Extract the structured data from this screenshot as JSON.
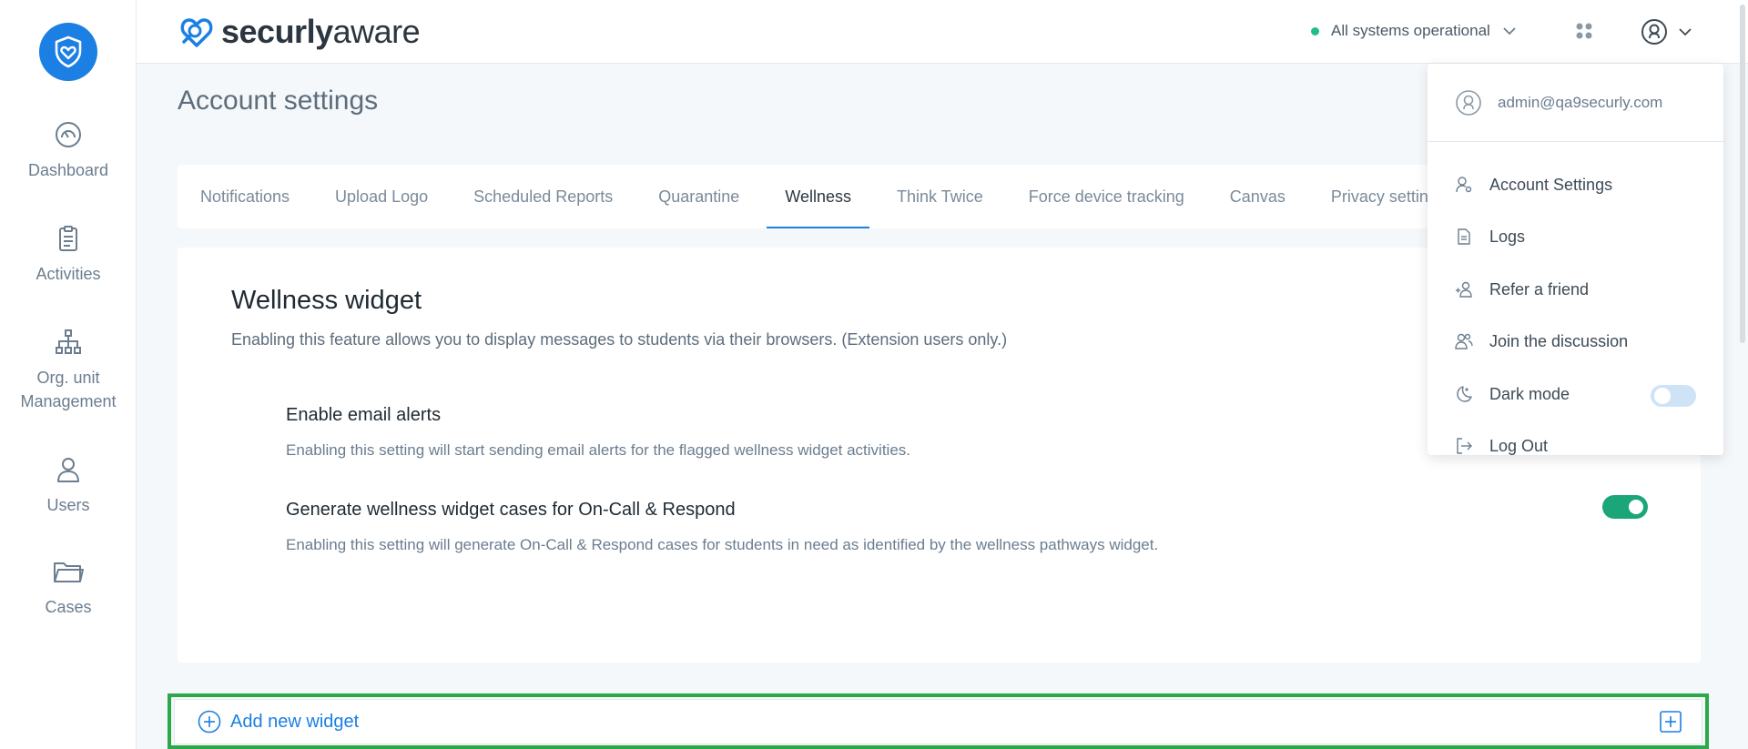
{
  "brand": {
    "name_bold": "securly",
    "name_light": "aware",
    "accent": "#1b7fe3"
  },
  "sidebar": {
    "items": [
      {
        "label": "Dashboard",
        "icon": "gauge-icon"
      },
      {
        "label": "Activities",
        "icon": "clipboard-icon"
      },
      {
        "label": "Org. unit Management",
        "line1": "Org. unit",
        "line2": "Management",
        "icon": "org-chart-icon"
      },
      {
        "label": "Users",
        "icon": "user-icon"
      },
      {
        "label": "Cases",
        "icon": "folder-icon"
      }
    ]
  },
  "header": {
    "status_text": "All systems operational",
    "status_color": "#1fbf86"
  },
  "page": {
    "title": "Account settings",
    "tabs": [
      {
        "label": "Notifications",
        "active": false
      },
      {
        "label": "Upload Logo",
        "active": false
      },
      {
        "label": "Scheduled Reports",
        "active": false
      },
      {
        "label": "Quarantine",
        "active": false
      },
      {
        "label": "Wellness",
        "active": true
      },
      {
        "label": "Think Twice",
        "active": false
      },
      {
        "label": "Force device tracking",
        "active": false
      },
      {
        "label": "Canvas",
        "active": false
      },
      {
        "label": "Privacy setting",
        "active": false
      }
    ]
  },
  "wellness": {
    "title": "Wellness widget",
    "description": "Enabling this feature allows you to display messages to students via their browsers. (Extension users only.)",
    "settings": [
      {
        "title": "Enable email alerts",
        "description": "Enabling this setting will start sending email alerts for the flagged wellness widget activities."
      },
      {
        "title": "Generate wellness widget cases for On-Call & Respond",
        "description": "Enabling this setting will generate On-Call & Respond cases for students in need as identified by the wellness pathways widget.",
        "enabled": true
      }
    ],
    "add_widget_label": "Add new widget"
  },
  "user_menu": {
    "email": "admin@qa9securly.com",
    "items": [
      {
        "label": "Account Settings",
        "icon": "user-gear-icon"
      },
      {
        "label": "Logs",
        "icon": "document-icon"
      },
      {
        "label": "Refer a friend",
        "icon": "add-user-icon"
      },
      {
        "label": "Join the discussion",
        "icon": "users-icon"
      },
      {
        "label": "Dark mode",
        "icon": "moon-icon",
        "enabled": false
      },
      {
        "label": "Log Out",
        "icon": "logout-icon"
      }
    ]
  }
}
